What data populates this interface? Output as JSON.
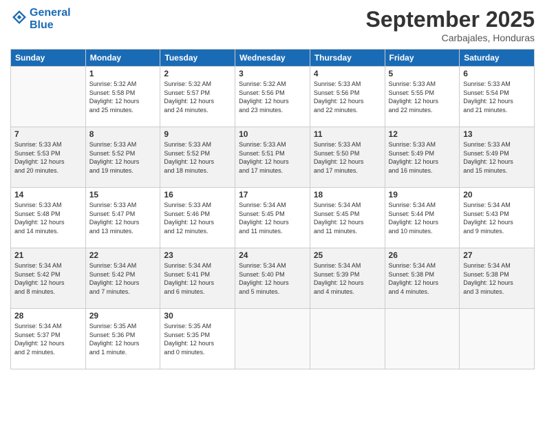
{
  "header": {
    "logo_line1": "General",
    "logo_line2": "Blue",
    "month": "September 2025",
    "location": "Carbajales, Honduras"
  },
  "days_of_week": [
    "Sunday",
    "Monday",
    "Tuesday",
    "Wednesday",
    "Thursday",
    "Friday",
    "Saturday"
  ],
  "weeks": [
    [
      {
        "day": "",
        "info": ""
      },
      {
        "day": "1",
        "info": "Sunrise: 5:32 AM\nSunset: 5:58 PM\nDaylight: 12 hours\nand 25 minutes."
      },
      {
        "day": "2",
        "info": "Sunrise: 5:32 AM\nSunset: 5:57 PM\nDaylight: 12 hours\nand 24 minutes."
      },
      {
        "day": "3",
        "info": "Sunrise: 5:32 AM\nSunset: 5:56 PM\nDaylight: 12 hours\nand 23 minutes."
      },
      {
        "day": "4",
        "info": "Sunrise: 5:33 AM\nSunset: 5:56 PM\nDaylight: 12 hours\nand 22 minutes."
      },
      {
        "day": "5",
        "info": "Sunrise: 5:33 AM\nSunset: 5:55 PM\nDaylight: 12 hours\nand 22 minutes."
      },
      {
        "day": "6",
        "info": "Sunrise: 5:33 AM\nSunset: 5:54 PM\nDaylight: 12 hours\nand 21 minutes."
      }
    ],
    [
      {
        "day": "7",
        "info": "Sunrise: 5:33 AM\nSunset: 5:53 PM\nDaylight: 12 hours\nand 20 minutes."
      },
      {
        "day": "8",
        "info": "Sunrise: 5:33 AM\nSunset: 5:52 PM\nDaylight: 12 hours\nand 19 minutes."
      },
      {
        "day": "9",
        "info": "Sunrise: 5:33 AM\nSunset: 5:52 PM\nDaylight: 12 hours\nand 18 minutes."
      },
      {
        "day": "10",
        "info": "Sunrise: 5:33 AM\nSunset: 5:51 PM\nDaylight: 12 hours\nand 17 minutes."
      },
      {
        "day": "11",
        "info": "Sunrise: 5:33 AM\nSunset: 5:50 PM\nDaylight: 12 hours\nand 17 minutes."
      },
      {
        "day": "12",
        "info": "Sunrise: 5:33 AM\nSunset: 5:49 PM\nDaylight: 12 hours\nand 16 minutes."
      },
      {
        "day": "13",
        "info": "Sunrise: 5:33 AM\nSunset: 5:49 PM\nDaylight: 12 hours\nand 15 minutes."
      }
    ],
    [
      {
        "day": "14",
        "info": "Sunrise: 5:33 AM\nSunset: 5:48 PM\nDaylight: 12 hours\nand 14 minutes."
      },
      {
        "day": "15",
        "info": "Sunrise: 5:33 AM\nSunset: 5:47 PM\nDaylight: 12 hours\nand 13 minutes."
      },
      {
        "day": "16",
        "info": "Sunrise: 5:33 AM\nSunset: 5:46 PM\nDaylight: 12 hours\nand 12 minutes."
      },
      {
        "day": "17",
        "info": "Sunrise: 5:34 AM\nSunset: 5:45 PM\nDaylight: 12 hours\nand 11 minutes."
      },
      {
        "day": "18",
        "info": "Sunrise: 5:34 AM\nSunset: 5:45 PM\nDaylight: 12 hours\nand 11 minutes."
      },
      {
        "day": "19",
        "info": "Sunrise: 5:34 AM\nSunset: 5:44 PM\nDaylight: 12 hours\nand 10 minutes."
      },
      {
        "day": "20",
        "info": "Sunrise: 5:34 AM\nSunset: 5:43 PM\nDaylight: 12 hours\nand 9 minutes."
      }
    ],
    [
      {
        "day": "21",
        "info": "Sunrise: 5:34 AM\nSunset: 5:42 PM\nDaylight: 12 hours\nand 8 minutes."
      },
      {
        "day": "22",
        "info": "Sunrise: 5:34 AM\nSunset: 5:42 PM\nDaylight: 12 hours\nand 7 minutes."
      },
      {
        "day": "23",
        "info": "Sunrise: 5:34 AM\nSunset: 5:41 PM\nDaylight: 12 hours\nand 6 minutes."
      },
      {
        "day": "24",
        "info": "Sunrise: 5:34 AM\nSunset: 5:40 PM\nDaylight: 12 hours\nand 5 minutes."
      },
      {
        "day": "25",
        "info": "Sunrise: 5:34 AM\nSunset: 5:39 PM\nDaylight: 12 hours\nand 4 minutes."
      },
      {
        "day": "26",
        "info": "Sunrise: 5:34 AM\nSunset: 5:38 PM\nDaylight: 12 hours\nand 4 minutes."
      },
      {
        "day": "27",
        "info": "Sunrise: 5:34 AM\nSunset: 5:38 PM\nDaylight: 12 hours\nand 3 minutes."
      }
    ],
    [
      {
        "day": "28",
        "info": "Sunrise: 5:34 AM\nSunset: 5:37 PM\nDaylight: 12 hours\nand 2 minutes."
      },
      {
        "day": "29",
        "info": "Sunrise: 5:35 AM\nSunset: 5:36 PM\nDaylight: 12 hours\nand 1 minute."
      },
      {
        "day": "30",
        "info": "Sunrise: 5:35 AM\nSunset: 5:35 PM\nDaylight: 12 hours\nand 0 minutes."
      },
      {
        "day": "",
        "info": ""
      },
      {
        "day": "",
        "info": ""
      },
      {
        "day": "",
        "info": ""
      },
      {
        "day": "",
        "info": ""
      }
    ]
  ]
}
